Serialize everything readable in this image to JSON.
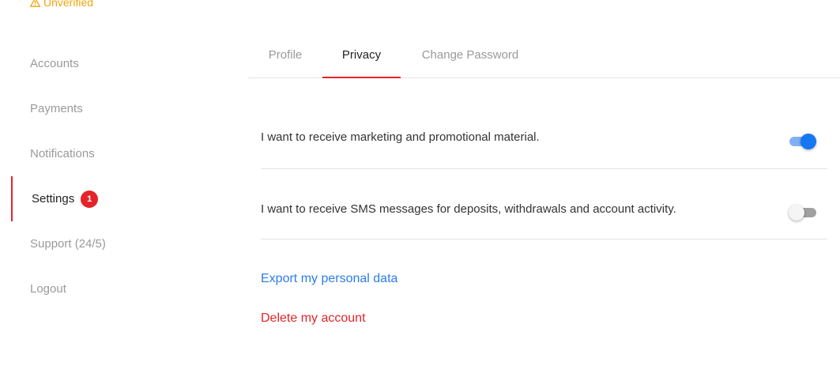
{
  "status": {
    "unverified_label": "Unverified",
    "icon": "warning-icon",
    "color": "#f2a40f"
  },
  "sidebar": {
    "items": [
      {
        "label": "Accounts"
      },
      {
        "label": "Payments"
      },
      {
        "label": "Notifications"
      },
      {
        "label": "Settings",
        "badge": "1",
        "active": true
      },
      {
        "label": "Support (24/5)"
      },
      {
        "label": "Logout"
      }
    ]
  },
  "tabs": [
    {
      "label": "Profile"
    },
    {
      "label": "Privacy",
      "active": true
    },
    {
      "label": "Change Password"
    }
  ],
  "privacy": {
    "marketing": {
      "label": "I want to receive marketing and promotional material.",
      "enabled": true
    },
    "sms": {
      "label": "I want to receive SMS messages for deposits, withdrawals and account activity.",
      "enabled": false
    },
    "export_link": "Export my personal data",
    "delete_link": "Delete my account"
  },
  "colors": {
    "accent": "#e4242b",
    "link": "#2b7de9",
    "toggle_on": "#1677f2"
  }
}
